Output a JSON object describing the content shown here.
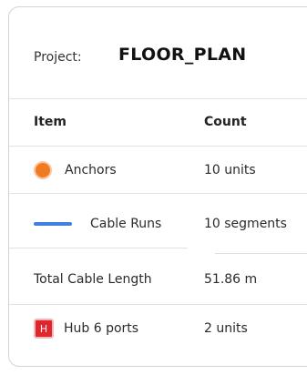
{
  "project": {
    "label": "Project:",
    "name": "FLOOR_PLAN"
  },
  "table": {
    "headers": {
      "item": "Item",
      "count": "Count"
    },
    "rows": [
      {
        "item": "Anchors",
        "count": "10 units",
        "icon": "orange-circle-icon"
      },
      {
        "item": "Cable Runs",
        "count": "10 segments",
        "icon": "blue-line-icon"
      },
      {
        "item": "Total Cable Length",
        "count": "51.86 m"
      },
      {
        "item": "Hub 6 ports",
        "count": "2 units",
        "icon": "hub-icon",
        "icon_text": "H"
      }
    ]
  },
  "colors": {
    "anchor": "#f17b20",
    "cable": "#3f7fe0",
    "hub": "#e0262c"
  }
}
